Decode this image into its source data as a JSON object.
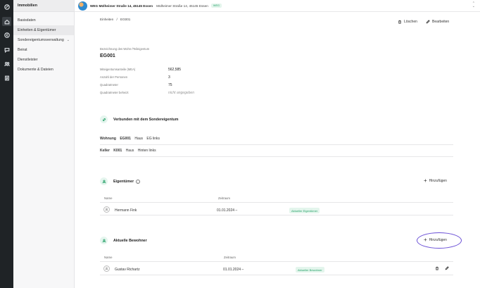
{
  "sidebar": {
    "header": "Immobilien",
    "items": [
      {
        "label": "Basisdaten"
      },
      {
        "label": "Einheiten & Eigentümer"
      },
      {
        "label": "Sondereigentumsverwaltung"
      },
      {
        "label": "Beirat"
      },
      {
        "label": "Dienstleister"
      },
      {
        "label": "Dokumente & Dateien"
      }
    ]
  },
  "topbar": {
    "property_name": "WEG Mülheimer Straße 14, 45145 Essen",
    "address": "Mülheimer Straße 14, 45145 Essen",
    "badge": "WEG"
  },
  "breadcrumb": {
    "parent": "Einheiten",
    "sep": "/",
    "current": "EG001"
  },
  "actions": {
    "delete": "Löschen",
    "edit": "Bearbeiten"
  },
  "unit": {
    "caption": "Bezeichnung des Wohn-/Teileigentum",
    "name": "EG001",
    "fields": [
      {
        "label": "Miteigentumsanteile (MEA)",
        "value": "562,585"
      },
      {
        "label": "Anzahl der Personen",
        "value": "3"
      },
      {
        "label": "Quadratmeter",
        "value": "75"
      },
      {
        "label": "Quadratmeter beheizt",
        "value": "nicht angegeben"
      }
    ]
  },
  "linked": {
    "title": "Verbunden mit dem Sondereigentum",
    "rows": [
      {
        "type": "Wohnung",
        "id": "EG001",
        "building": "Haus",
        "location": "EG links"
      },
      {
        "type": "Keller",
        "id": "K001",
        "building": "Haus",
        "location": "Hinten links"
      }
    ]
  },
  "owners": {
    "title": "Eigentümer",
    "add": "Hinzufügen",
    "col_name": "Name",
    "col_period": "Zeitraum",
    "rows": [
      {
        "name": "Hermann Fink",
        "period": "01.01.2024 –",
        "status": "Aktueller Eigentümer"
      }
    ]
  },
  "residents": {
    "title": "Aktuelle Bewohner",
    "add": "Hinzufügen",
    "col_name": "Name",
    "col_period": "Zeitraum",
    "rows": [
      {
        "name": "Gustav Richartz",
        "period": "01.01.2024 –",
        "status": "Aktueller Bewohner"
      }
    ]
  },
  "colors": {
    "accent": "#2aa36b",
    "highlight": "#6a4fd6",
    "rail": "#1f2326"
  }
}
